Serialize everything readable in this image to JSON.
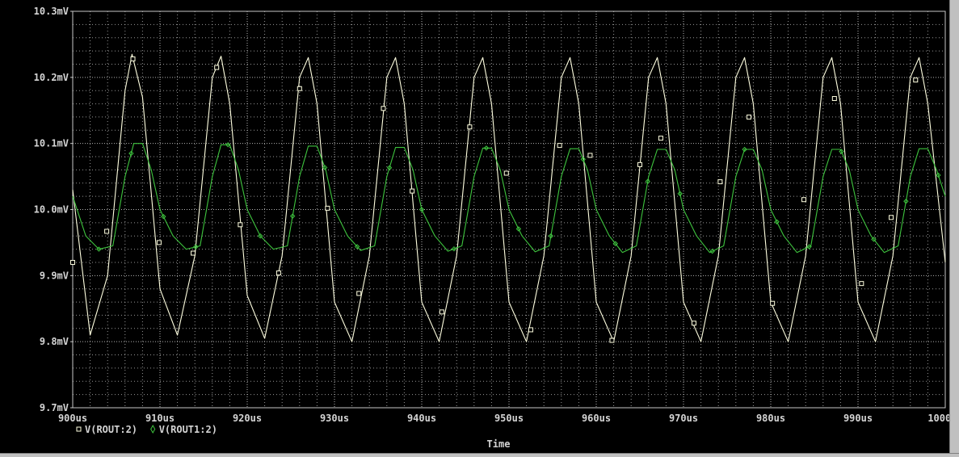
{
  "chart_data": {
    "type": "line",
    "xlabel": "Time",
    "ylabel": "",
    "xlim": [
      900,
      1000
    ],
    "ylim": [
      9.7,
      10.3
    ],
    "x_unit": "us",
    "y_unit": "mV",
    "x_ticks": [
      "900us",
      "910us",
      "920us",
      "930us",
      "940us",
      "950us",
      "960us",
      "970us",
      "980us",
      "990us",
      "1000us"
    ],
    "y_ticks": [
      "10.3mV",
      "10.2mV",
      "10.1mV",
      "10.0mV",
      "9.9mV",
      "9.8mV",
      "9.7mV"
    ],
    "grid": true,
    "legend_position": "bottom-left",
    "background": "#000000",
    "series": [
      {
        "name": "V(ROUT:2)",
        "color": "#ffffe0",
        "marker": "square",
        "x": [
          900,
          902,
          904,
          906,
          906.8,
          908,
          910,
          912,
          914,
          916,
          917,
          918,
          920,
          922,
          924,
          926,
          927,
          928,
          930,
          932,
          934,
          936,
          937,
          938,
          940,
          942,
          944,
          946,
          947,
          948,
          950,
          952,
          954,
          956,
          957,
          958,
          960,
          962,
          964,
          966,
          967,
          968,
          970,
          972,
          974,
          976,
          977,
          978,
          980,
          982,
          984,
          986,
          987,
          988,
          990,
          992,
          994,
          996,
          997,
          998,
          1000
        ],
        "values": [
          10.03,
          9.81,
          9.9,
          10.18,
          10.235,
          10.17,
          9.88,
          9.81,
          9.93,
          10.2,
          10.232,
          10.16,
          9.87,
          9.805,
          9.93,
          10.2,
          10.23,
          10.16,
          9.86,
          9.8,
          9.93,
          10.2,
          10.23,
          10.16,
          9.86,
          9.8,
          9.93,
          10.2,
          10.23,
          10.16,
          9.86,
          9.8,
          9.93,
          10.2,
          10.23,
          10.16,
          9.86,
          9.8,
          9.93,
          10.2,
          10.23,
          10.16,
          9.86,
          9.8,
          9.93,
          10.2,
          10.23,
          10.16,
          9.86,
          9.8,
          9.93,
          10.2,
          10.23,
          10.16,
          9.86,
          9.8,
          9.93,
          10.2,
          10.23,
          10.16,
          9.92
        ],
        "markers_x": [
          900,
          903.9,
          906.9,
          909.9,
          913.8,
          916.5,
          919.2,
          923.6,
          926.0,
          929.2,
          932.8,
          935.6,
          938.9,
          942.3,
          945.5,
          949.7,
          952.5,
          955.8,
          959.3,
          961.8,
          965.0,
          967.4,
          971.2,
          974.2,
          977.5,
          980.2,
          983.8,
          987.3,
          990.4,
          993.8,
          996.6
        ],
        "markers_y": [
          9.92,
          9.967,
          10.228,
          9.95,
          9.934,
          10.215,
          9.977,
          9.904,
          10.183,
          10.002,
          9.873,
          10.153,
          10.028,
          9.845,
          10.125,
          10.055,
          9.818,
          10.097,
          10.082,
          9.802,
          10.068,
          10.108,
          9.828,
          10.042,
          10.14,
          9.858,
          10.015,
          10.168,
          9.888,
          9.988,
          10.196
        ]
      },
      {
        "name": "V(ROUT1:2)",
        "color": "#3ec43e",
        "marker": "diamond",
        "x": [
          900,
          901.5,
          903,
          904.6,
          906,
          907,
          908,
          909,
          910,
          911.5,
          913,
          914.6,
          916,
          917,
          918,
          919,
          920,
          921.5,
          923,
          924.6,
          926,
          927,
          928,
          929,
          930,
          931.5,
          933,
          934.6,
          936,
          937,
          938,
          939,
          940,
          941.5,
          943,
          944.6,
          946,
          947,
          948,
          949,
          950,
          951.5,
          953,
          954.6,
          956,
          957,
          958,
          959,
          960,
          961.5,
          963,
          964.6,
          966,
          967,
          968,
          969,
          970,
          971.5,
          973,
          974.6,
          976,
          977,
          978,
          979,
          980,
          981.5,
          983,
          984.6,
          986,
          987,
          988,
          989,
          990,
          991.5,
          993,
          994.6,
          996,
          997,
          998,
          999,
          1000
        ],
        "values": [
          10.02,
          9.96,
          9.94,
          9.945,
          10.05,
          10.1,
          10.1,
          10.06,
          10.0,
          9.96,
          9.94,
          9.945,
          10.05,
          10.098,
          10.098,
          10.06,
          10.0,
          9.96,
          9.94,
          9.945,
          10.05,
          10.096,
          10.096,
          10.06,
          10.0,
          9.96,
          9.938,
          9.945,
          10.05,
          10.094,
          10.094,
          10.06,
          10.0,
          9.96,
          9.937,
          9.945,
          10.05,
          10.093,
          10.093,
          10.06,
          10.0,
          9.96,
          9.936,
          9.945,
          10.05,
          10.092,
          10.092,
          10.06,
          10.0,
          9.96,
          9.935,
          9.945,
          10.05,
          10.091,
          10.091,
          10.06,
          10.0,
          9.96,
          9.935,
          9.945,
          10.05,
          10.091,
          10.091,
          10.06,
          10.0,
          9.96,
          9.935,
          9.945,
          10.05,
          10.091,
          10.091,
          10.06,
          10.0,
          9.96,
          9.935,
          9.945,
          10.05,
          10.092,
          10.092,
          10.06,
          10.02
        ]
      }
    ]
  },
  "legend": {
    "items": [
      {
        "label": "V(ROUT:2)",
        "marker": "square",
        "color": "#ffffe0"
      },
      {
        "label": "V(ROUT1:2)",
        "marker": "diamond",
        "color": "#3ec43e"
      }
    ]
  },
  "axis_title_x": "Time",
  "colors": {
    "background": "#000000",
    "grid": "#c8c8c8",
    "axis_text": "#d4d4d4",
    "frame": "#c0c0c0"
  }
}
